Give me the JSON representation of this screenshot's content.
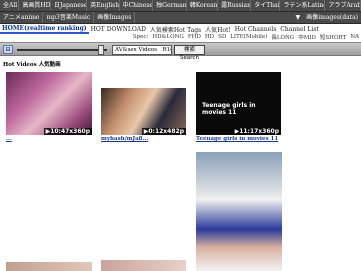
{
  "nav": {
    "row1": [
      "全All",
      "高画質HD",
      "日Japanese",
      "英English",
      "中Chinese",
      "独German",
      "韓Korean",
      "露Russian",
      "タイThai",
      "ラテン系Latino",
      "アラブArab"
    ],
    "row2": [
      "アニメanime",
      "mp3音楽Music",
      "画像Images"
    ],
    "row2_right": "画像images(data)",
    "row2_arrow": "▼"
  },
  "tabs": [
    {
      "label": "HOME(realtime ranking)",
      "active": true
    },
    {
      "label": "HOT DOWNLOAD",
      "active": false
    },
    {
      "label": "人気検索Hot Tags",
      "active": false
    },
    {
      "label": "人気Hot!",
      "active": false
    },
    {
      "label": "Hot Channels",
      "active": false
    },
    {
      "label": "Channel List",
      "active": false
    }
  ],
  "subrow": [
    "Spec:",
    "HD&LONG",
    "FHD",
    "HD",
    "SD",
    "LITE(Mobile)",
    "長LONG",
    "中MID",
    "短SHORT",
    "NA"
  ],
  "search": {
    "left_button": "⊟",
    "select_value": "AV&sex Videos　R18+",
    "button_label": "検索Search"
  },
  "section_title": "Hot Videos 人気動画",
  "videos": [
    {
      "badge": "▶10:47x360p",
      "caption": "..."
    },
    {
      "badge": "▶0:12x482p",
      "caption": "myhash/mJa8..."
    },
    {
      "badge": "▶11:17x360p",
      "caption": "Teenage girls in movies 11",
      "overlay_text": "Teenage girls in movies 11"
    },
    {
      "badge": "",
      "caption": ""
    },
    {
      "badge": "",
      "caption": ""
    },
    {
      "badge": "",
      "caption": ""
    }
  ],
  "colors": {
    "nav_bg": "#4a4a4a",
    "tab_active": "#003399",
    "caption_link": "#1a3a8a",
    "search_bar": "#9e9e9e"
  }
}
